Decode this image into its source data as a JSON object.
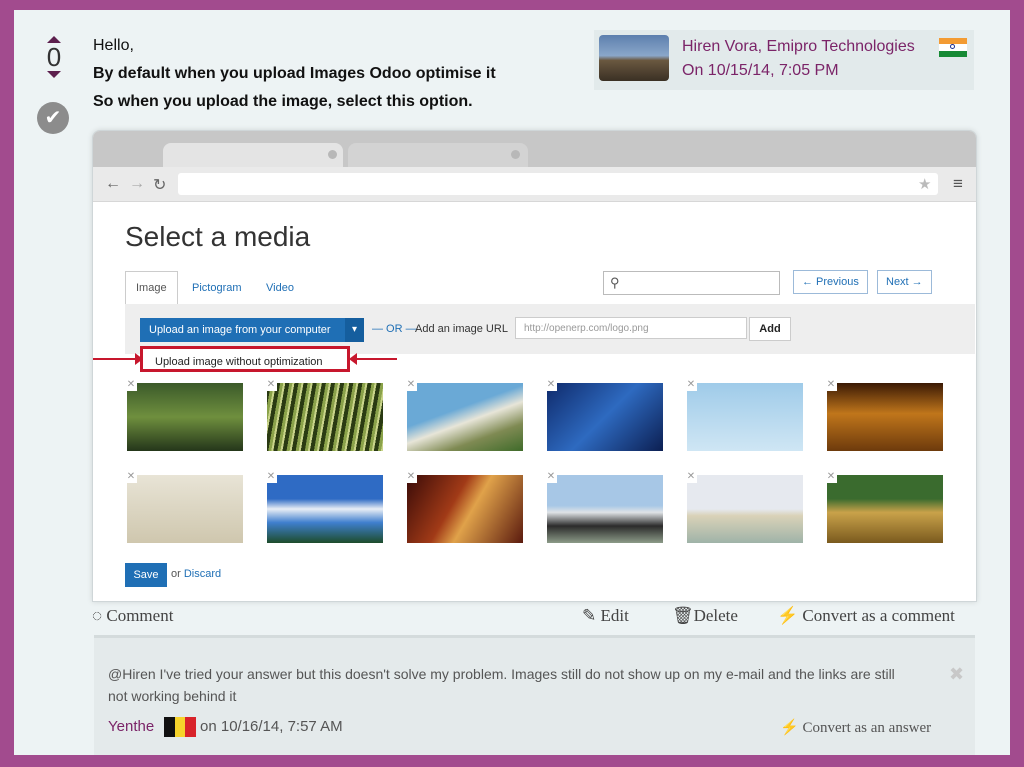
{
  "vote": {
    "count": "0"
  },
  "post": {
    "line1": "Hello,",
    "line2": "By default when you upload Images Odoo optimise it",
    "line3": "So when you upload the image, select this option."
  },
  "author": {
    "name": "Hiren Vora, Emipro Technologies",
    "date": "On 10/15/14, 7:05 PM"
  },
  "dialog": {
    "title": "Select a media",
    "tabs": [
      "Image",
      "Pictogram",
      "Video"
    ],
    "prev": "← Previous",
    "next": "Next →",
    "upload_btn": "Upload an image from your computer",
    "or": "— OR —",
    "url_label": "Add an image URL",
    "url_placeholder": "http://openerp.com/logo.png",
    "add": "Add",
    "dropdown_item": "Upload image without optimization",
    "save": "Save",
    "or_text": "or",
    "discard": "Discard"
  },
  "actions": {
    "comment": "Comment",
    "edit": "Edit",
    "delete": "Delete",
    "convert": "Convert as a comment"
  },
  "comment": {
    "text": "@Hiren I've tried your answer but this doesn't solve my problem. Images still do not show up on my e-mail and the links are still not working behind it",
    "author": "Yenthe",
    "date": "on 10/16/14, 7:57 AM",
    "convert": "Convert as an answer"
  },
  "icons": {
    "accept": "check-icon",
    "close": "close-icon",
    "search": "search-icon",
    "edit": "pencil-icon",
    "delete": "trash-icon",
    "comment": "speech-bubble-icon",
    "convert": "wand-icon"
  },
  "colors": {
    "accent": "#7b2468",
    "primary": "#1f6fb5",
    "highlight": "#c7172d",
    "frame": "#a24b8e"
  }
}
